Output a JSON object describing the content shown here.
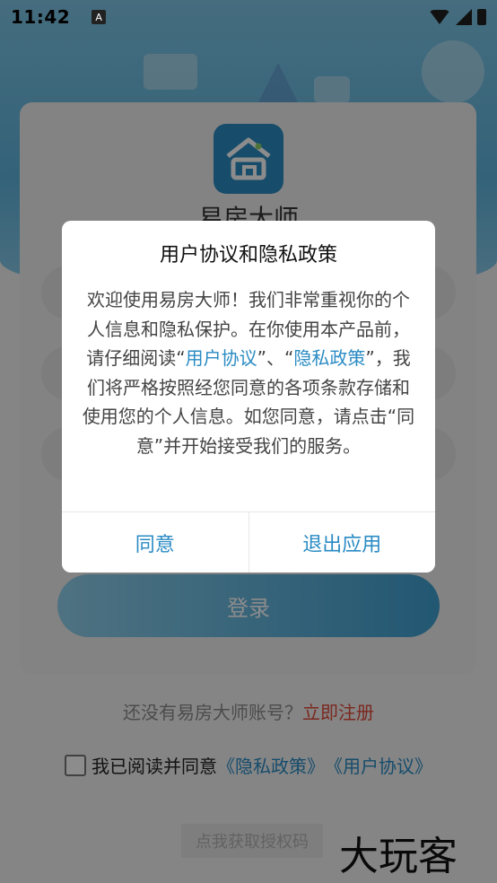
{
  "status_bar": {
    "time": "11:42",
    "notif_icon": "A"
  },
  "app": {
    "name": "易房大师",
    "accent": "#2a8bc4"
  },
  "login": {
    "button_label": "登录"
  },
  "register": {
    "prompt": "还没有易房大师账号？",
    "link": "立即注册"
  },
  "agreement": {
    "prefix": "我已阅读并同意",
    "privacy_link": "《隐私政策》",
    "user_link": "《用户协议》"
  },
  "auth_code_button": "点我获取授权码",
  "watermark": "大玩客",
  "dialog": {
    "title": "用户协议和隐私政策",
    "body_part1": "欢迎使用易房大师！我们非常重视你的个人信息和隐私保护。在你使用本产品前，请仔细阅读“",
    "link_user": "用户协议",
    "body_part2": "”、“",
    "link_privacy": "隐私政策",
    "body_part3": "”，我们将严格按照经您同意的各项条款存储和使用您的个人信息。如您同意，请点击“同意”并开始接受我们的服务。",
    "agree_label": "同意",
    "exit_label": "退出应用"
  }
}
